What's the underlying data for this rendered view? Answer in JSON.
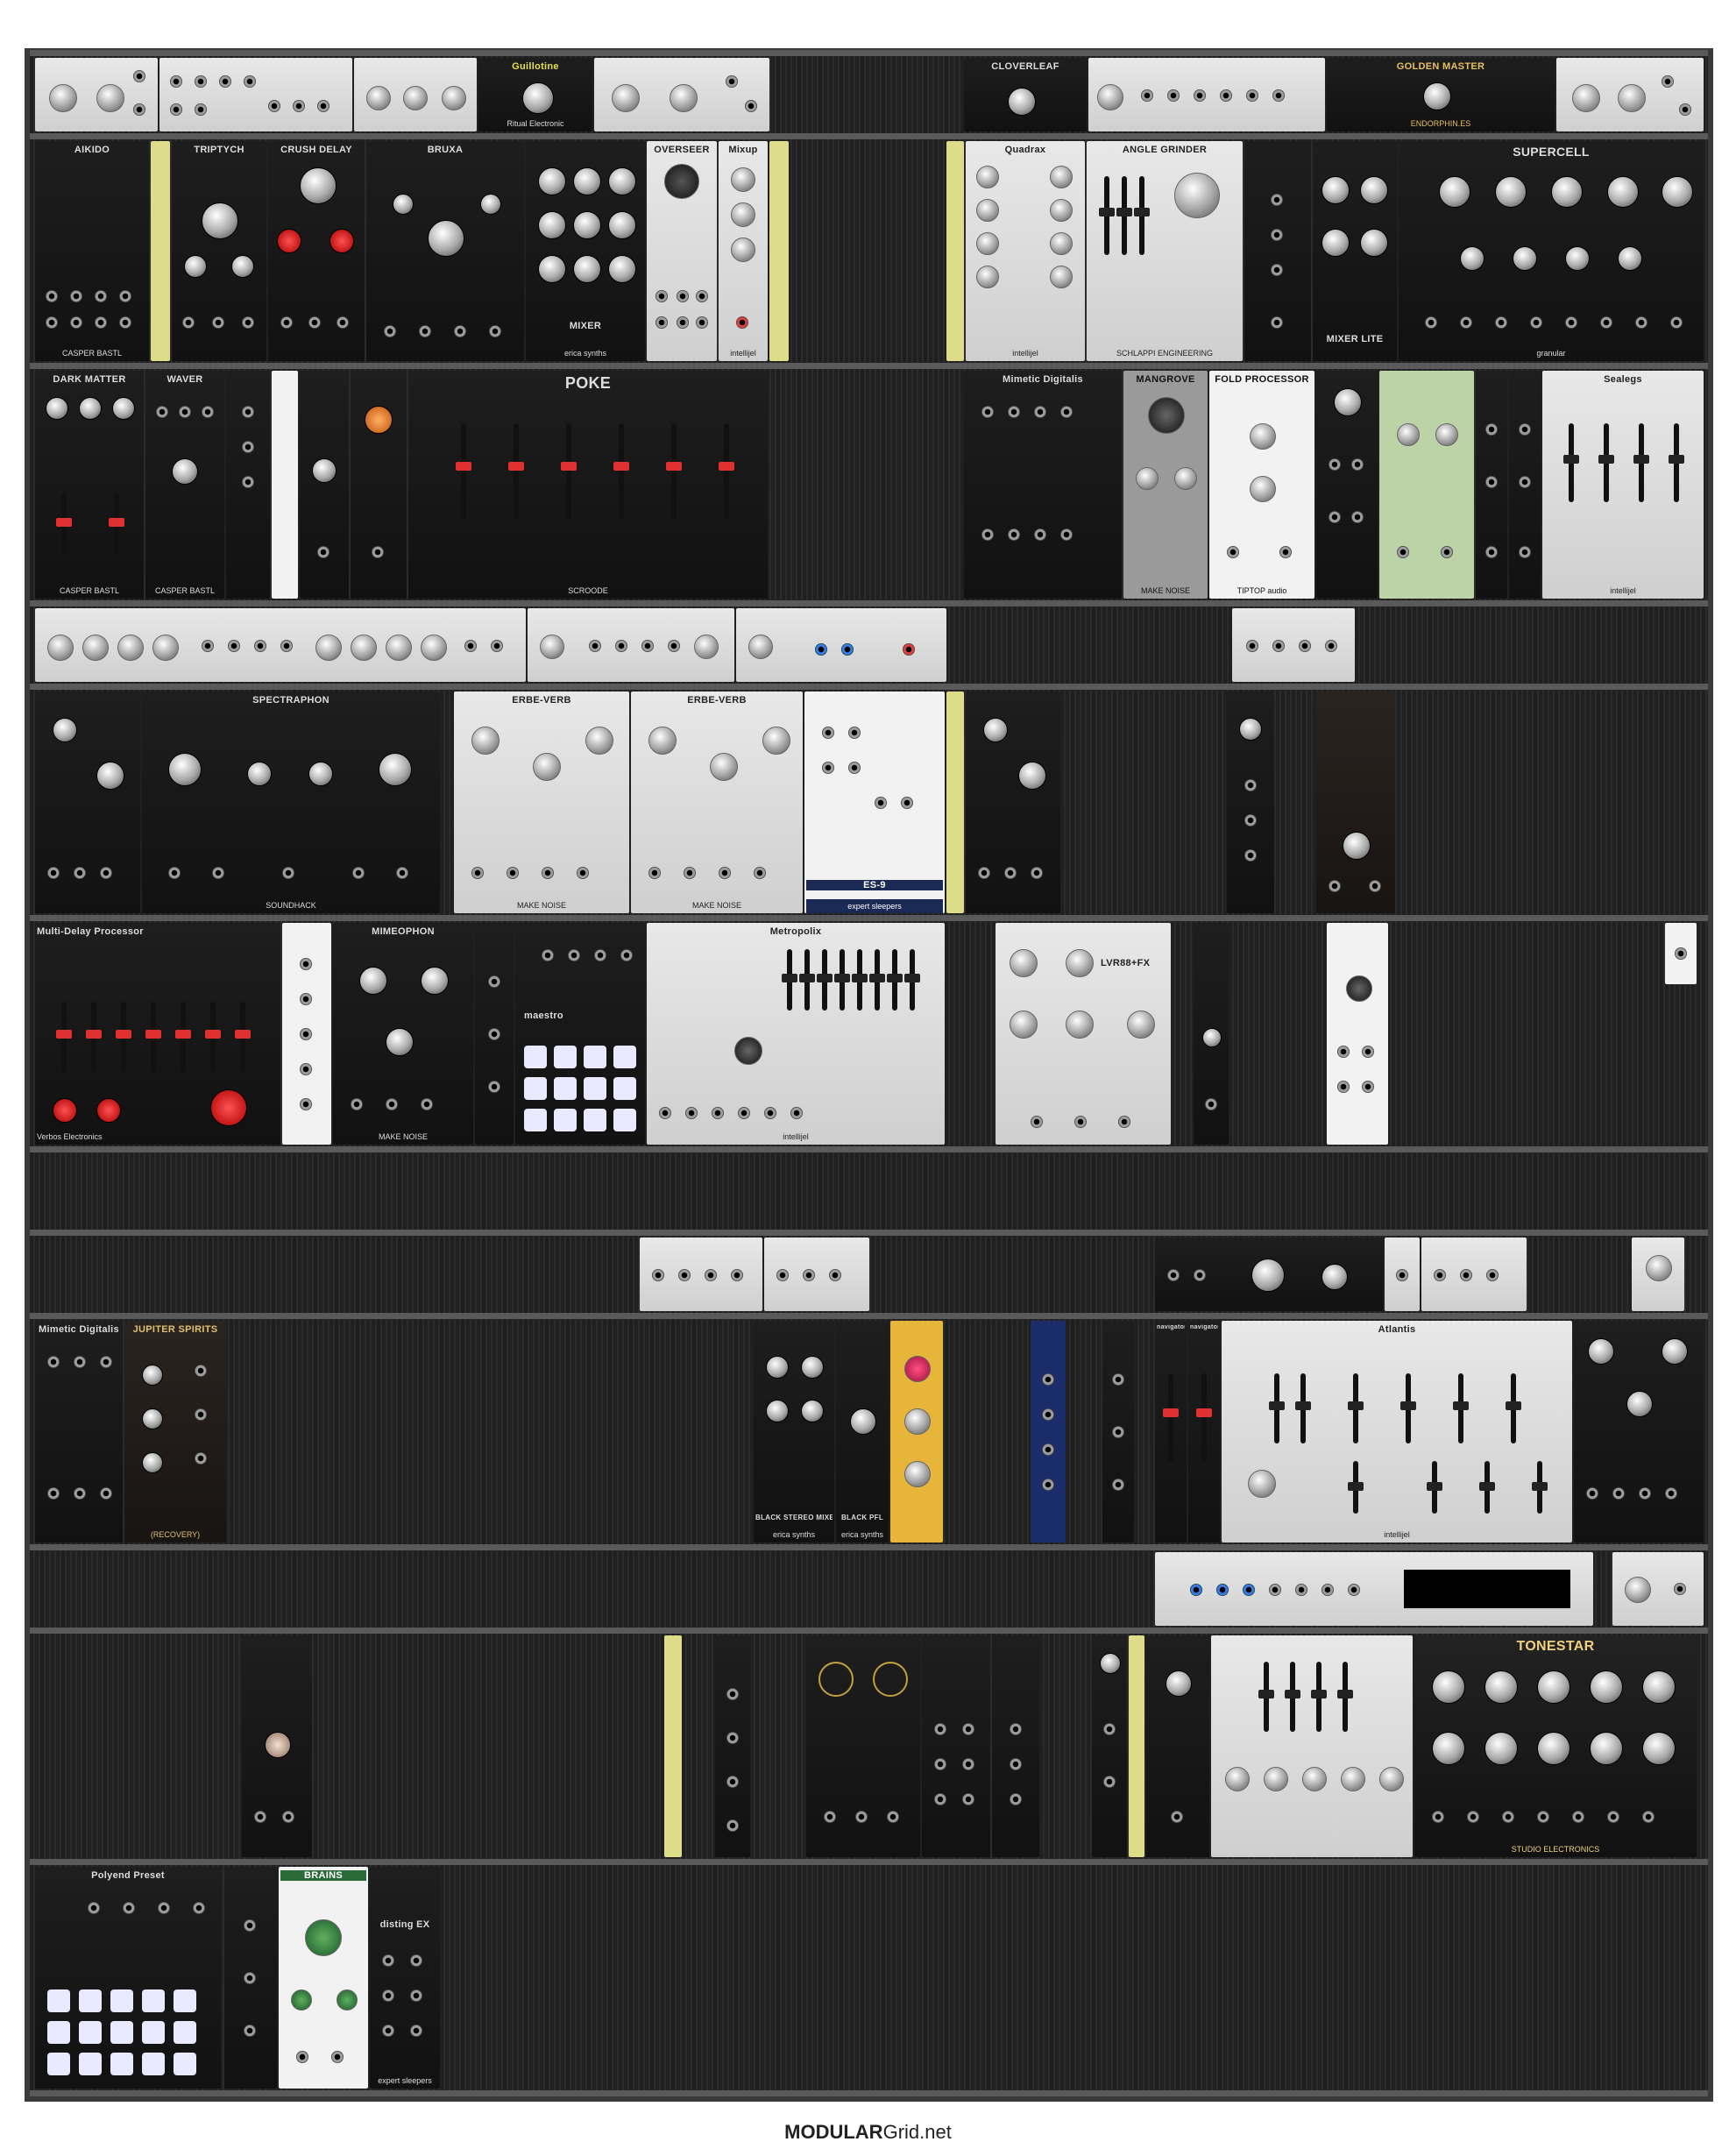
{
  "footer": {
    "brand_bold": "MODULAR",
    "brand_rest": "Grid.net"
  },
  "modules": [
    {
      "label": "Guillotine",
      "brand": "Ritual Electronic"
    },
    {
      "label": "CLOVERLEAF",
      "brand": ""
    },
    {
      "label": "GOLDEN MASTER",
      "brand": "ENDORPHIN.ES"
    },
    {
      "label": "AIKIDO",
      "brand": "CASPER BASTL"
    },
    {
      "label": "TRIPTYCH",
      "brand": ""
    },
    {
      "label": "CRUSH DELAY",
      "brand": ""
    },
    {
      "label": "BRUXA",
      "brand": ""
    },
    {
      "label": "MIXER",
      "brand": "erica synths"
    },
    {
      "label": "OVERSEER",
      "brand": ""
    },
    {
      "label": "Mixup",
      "brand": "intellijel"
    },
    {
      "label": "Quadrax",
      "brand": "intellijel"
    },
    {
      "label": "ANGLE GRINDER",
      "brand": "SCHLAPPI ENGINEERING"
    },
    {
      "label": "MIXER LITE",
      "brand": ""
    },
    {
      "label": "SUPERCELL",
      "brand": "granular"
    },
    {
      "label": "DARK MATTER",
      "brand": "CASPER BASTL"
    },
    {
      "label": "WAVER",
      "brand": "CASPER BASTL"
    },
    {
      "label": "POKE",
      "brand": "SCROODE"
    },
    {
      "label": "Mimetic Digitalis",
      "brand": ""
    },
    {
      "label": "MANGROVE",
      "brand": "MAKE NOISE"
    },
    {
      "label": "FOLD PROCESSOR",
      "brand": "TIPTOP audio"
    },
    {
      "label": "Sealegs",
      "brand": "intellijel"
    },
    {
      "label": "SPECTRAPHON",
      "brand": "SOUNDHACK"
    },
    {
      "label": "ERBE-VERB",
      "brand": "MAKE NOISE"
    },
    {
      "label": "ERBE-VERB",
      "brand": "MAKE NOISE"
    },
    {
      "label": "ES-9",
      "brand": "expert sleepers"
    },
    {
      "label": "Multi-Delay Processor",
      "brand": "Verbos Electronics"
    },
    {
      "label": "MIMEOPHON",
      "brand": "MAKE NOISE"
    },
    {
      "label": "maestro",
      "brand": ""
    },
    {
      "label": "Metropolix",
      "brand": "intellijel"
    },
    {
      "label": "LVR88+FX",
      "brand": ""
    },
    {
      "label": "Mimetic Digitalis",
      "brand": ""
    },
    {
      "label": "JUPITER SPIRITS",
      "brand": "(RECOVERY)"
    },
    {
      "label": "BLACK STEREO MIXER",
      "brand": "erica synths"
    },
    {
      "label": "BLACK PFL",
      "brand": "erica synths"
    },
    {
      "label": "navigator",
      "brand": ""
    },
    {
      "label": "navigator",
      "brand": ""
    },
    {
      "label": "Atlantis",
      "brand": "intellijel"
    },
    {
      "label": "TONESTAR",
      "brand": "STUDIO ELECTRONICS"
    },
    {
      "label": "Polyend Preset",
      "brand": ""
    },
    {
      "label": "BRAINS",
      "brand": ""
    },
    {
      "label": "disting EX",
      "brand": "expert sleepers"
    }
  ]
}
